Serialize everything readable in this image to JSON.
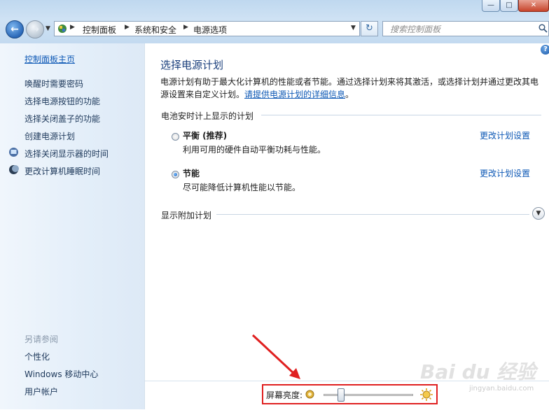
{
  "window": {
    "minimize_label": "—",
    "maximize_label": "□",
    "close_label": "✕"
  },
  "nav": {
    "back_label": "←",
    "forward_label": "→"
  },
  "breadcrumb": {
    "items": [
      "控制面板",
      "系统和安全",
      "电源选项"
    ]
  },
  "search": {
    "placeholder": "搜索控制面板"
  },
  "sidebar": {
    "home_link": "控制面板主页",
    "items": [
      {
        "label": "唤醒时需要密码",
        "icon": ""
      },
      {
        "label": "选择电源按钮的功能",
        "icon": ""
      },
      {
        "label": "选择关闭盖子的功能",
        "icon": ""
      },
      {
        "label": "创建电源计划",
        "icon": ""
      },
      {
        "label": "选择关闭显示器的时间",
        "icon": "monitor-icon"
      },
      {
        "label": "更改计算机睡眠时间",
        "icon": "moon-icon"
      }
    ],
    "see_also_title": "另请参阅",
    "see_also_items": [
      "个性化",
      "Windows 移动中心",
      "用户帐户"
    ]
  },
  "main": {
    "title": "选择电源计划",
    "description": "电源计划有助于最大化计算机的性能或者节能。通过选择计划来将其激活，或选择计划并通过更改其电源设置来自定义计划。",
    "description_link": "请提供电源计划的详细信息",
    "description_end": "。",
    "group_title": "电池安时计上显示的计划",
    "plans": [
      {
        "name": "平衡 (推荐)",
        "desc": "利用可用的硬件自动平衡功耗与性能。",
        "selected": false,
        "change_label": "更改计划设置"
      },
      {
        "name": "节能",
        "desc": "尽可能降低计算机性能以节能。",
        "selected": true,
        "change_label": "更改计划设置"
      }
    ],
    "additional_title": "显示附加计划"
  },
  "brightness": {
    "label": "屏幕亮度:",
    "value_fraction": 0.17
  },
  "colors": {
    "accent_link": "#0d58b5",
    "title_blue": "#1a3f7c",
    "highlight_red": "#e02020"
  }
}
